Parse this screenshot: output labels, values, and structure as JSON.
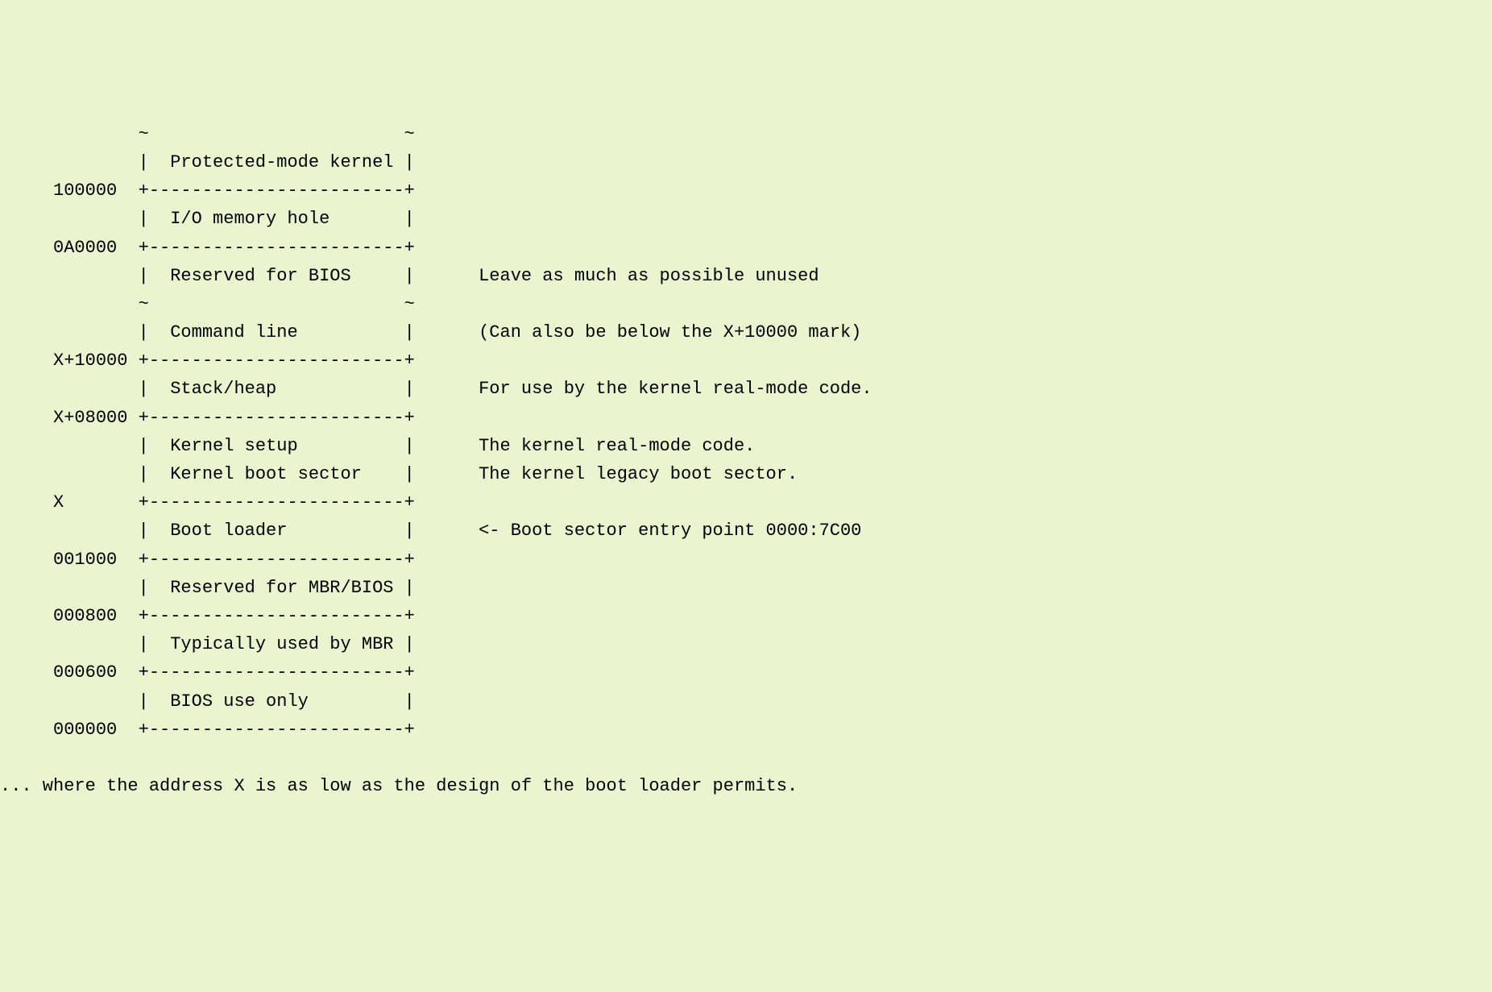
{
  "diagram": {
    "lines": [
      "             ~                        ~",
      "             |  Protected-mode kernel |",
      "     100000  +------------------------+",
      "             |  I/O memory hole       |",
      "     0A0000  +------------------------+",
      "             |  Reserved for BIOS     |      Leave as much as possible unused",
      "             ~                        ~",
      "             |  Command line          |      (Can also be below the X+10000 mark)",
      "     X+10000 +------------------------+",
      "             |  Stack/heap            |      For use by the kernel real-mode code.",
      "     X+08000 +------------------------+",
      "             |  Kernel setup          |      The kernel real-mode code.",
      "             |  Kernel boot sector    |      The kernel legacy boot sector.",
      "     X       +------------------------+",
      "             |  Boot loader           |      <- Boot sector entry point 0000:7C00",
      "     001000  +------------------------+",
      "             |  Reserved for MBR/BIOS |",
      "     000800  +------------------------+",
      "             |  Typically used by MBR |",
      "     000600  +------------------------+",
      "             |  BIOS use only         |",
      "     000000  +------------------------+",
      "",
      "... where the address X is as low as the design of the boot loader permits."
    ]
  }
}
